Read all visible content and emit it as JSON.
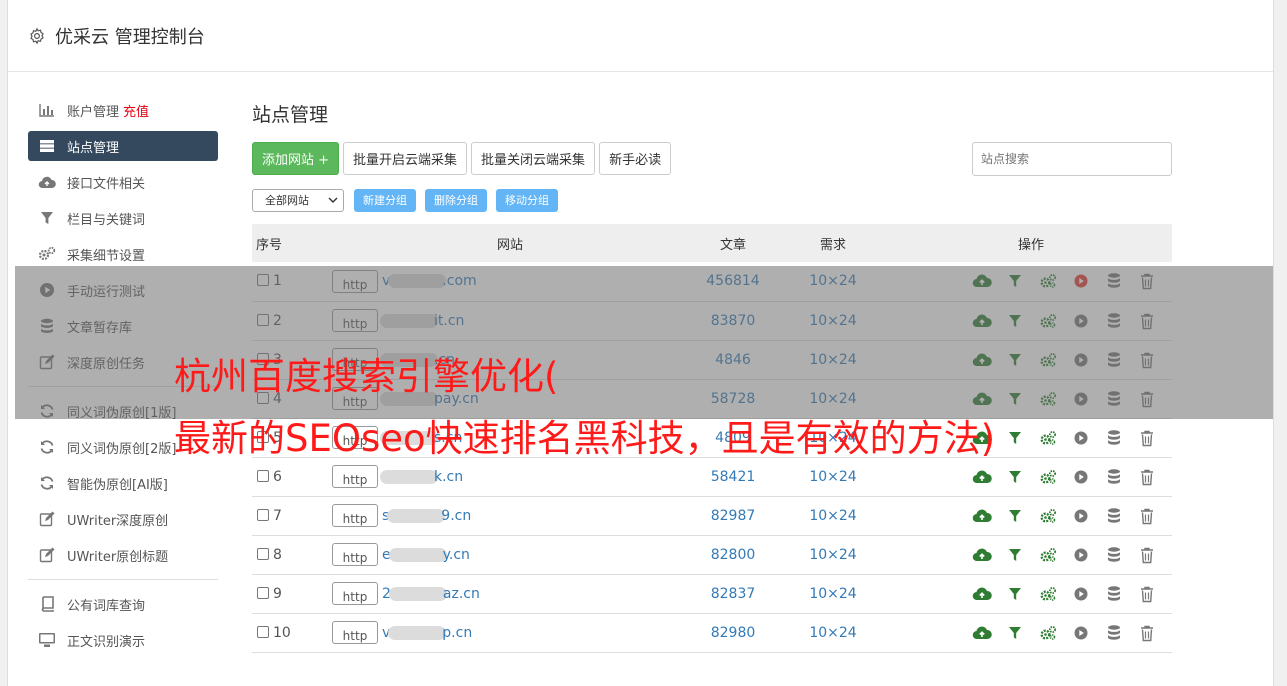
{
  "header": {
    "title": "优采云 管理控制台"
  },
  "sidebar": {
    "items": [
      {
        "label": "账户管理",
        "extra": "充值",
        "icon": "bar-chart-icon"
      },
      {
        "label": "站点管理",
        "icon": "server-icon",
        "active": true
      },
      {
        "label": "接口文件相关",
        "icon": "cloud-upload-icon"
      },
      {
        "label": "栏目与关键词",
        "icon": "filter-icon"
      },
      {
        "label": "采集细节设置",
        "icon": "gears-icon"
      },
      {
        "label": "手动运行测试",
        "icon": "play-icon"
      },
      {
        "label": "文章暂存库",
        "icon": "database-icon"
      },
      {
        "label": "深度原创任务",
        "icon": "edit-icon"
      },
      {
        "label": "同义词伪原创[1版]",
        "icon": "refresh-icon"
      },
      {
        "label": "同义词伪原创[2版]",
        "icon": "refresh-icon"
      },
      {
        "label": "智能伪原创[AI版]",
        "icon": "refresh-icon"
      },
      {
        "label": "UWriter深度原创",
        "icon": "edit-icon"
      },
      {
        "label": "UWriter原创标题",
        "icon": "edit-icon"
      },
      {
        "label": "公有词库查询",
        "icon": "book-icon"
      },
      {
        "label": "正文识别演示",
        "icon": "monitor-icon"
      }
    ]
  },
  "main": {
    "title": "站点管理",
    "buttons": {
      "add_site": "添加网站 +",
      "batch_open": "批量开启云端采集",
      "batch_close": "批量关闭云端采集",
      "guide": "新手必读"
    },
    "search_placeholder": "站点搜索",
    "group_select": "全部网站",
    "group_buttons": {
      "new": "新建分组",
      "delete": "删除分组",
      "move": "移动分组"
    },
    "table": {
      "headers": [
        "序号",
        "网站",
        "文章",
        "需求",
        "操作"
      ],
      "http_label": "http",
      "rows": [
        {
          "no": "1",
          "site_prefix": "v",
          "site_suffix": ".com",
          "articles": "456814",
          "need": "10×24"
        },
        {
          "no": "2",
          "site_prefix": "",
          "site_suffix": "it.cn",
          "articles": "83870",
          "need": "10×24"
        },
        {
          "no": "3",
          "site_prefix": "",
          "site_suffix": ".cn",
          "articles": "4846",
          "need": "10×24"
        },
        {
          "no": "4",
          "site_prefix": "",
          "site_suffix": "pay.cn",
          "articles": "58728",
          "need": "10×24"
        },
        {
          "no": "5",
          "site_prefix": "",
          "site_suffix": "s.cn",
          "articles": "4809",
          "need": "10×24"
        },
        {
          "no": "6",
          "site_prefix": "",
          "site_suffix": "k.cn",
          "articles": "58421",
          "need": "10×24"
        },
        {
          "no": "7",
          "site_prefix": "s",
          "site_suffix": "9.cn",
          "articles": "82987",
          "need": "10×24"
        },
        {
          "no": "8",
          "site_prefix": "e",
          "site_suffix": "y.cn",
          "articles": "82800",
          "need": "10×24"
        },
        {
          "no": "9",
          "site_prefix": "2",
          "site_suffix": "az.cn",
          "articles": "82837",
          "need": "10×24"
        },
        {
          "no": "10",
          "site_prefix": "v",
          "site_suffix": "p.cn",
          "articles": "82980",
          "need": "10×24"
        }
      ]
    }
  },
  "overlay": {
    "line1": "杭州百度搜索引擎优化(",
    "line2": "最新的SEOseo快速排名黑科技，且是有效的方法)"
  },
  "colors": {
    "active_nav": "#34495e",
    "link": "#337ab7",
    "green": "#5cb85c",
    "overlay_text": "#ff1a1a"
  }
}
